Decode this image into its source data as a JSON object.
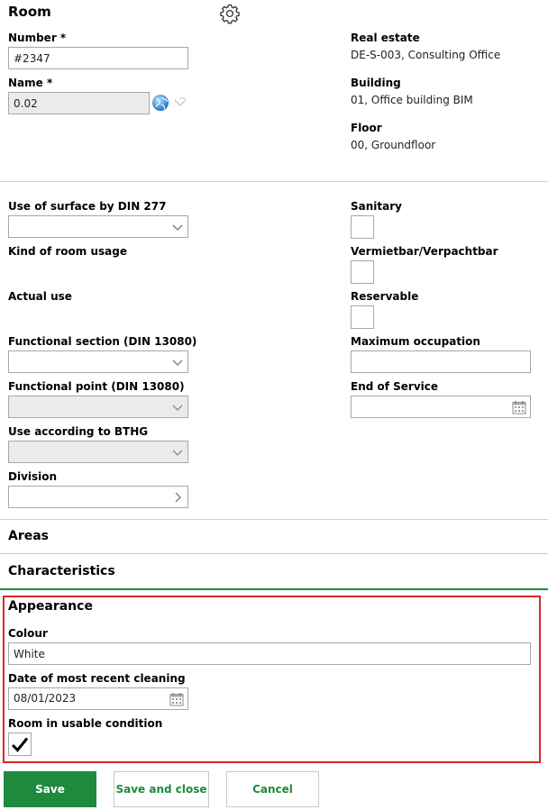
{
  "room": {
    "title": "Room",
    "number_label": "Number *",
    "number_value": "#2347",
    "name_label": "Name *",
    "name_value": "0.02",
    "real_estate_label": "Real estate",
    "real_estate_value": "DE-S-003, Consulting Office",
    "building_label": "Building",
    "building_value": "01, Office building BIM",
    "floor_label": "Floor",
    "floor_value": "00, Groundfloor"
  },
  "usage": {
    "surface_label": "Use of surface by DIN 277",
    "surface_value": "",
    "kind_label": "Kind of room usage",
    "actual_label": "Actual use",
    "functional_section_label": "Functional section (DIN 13080)",
    "functional_point_label": "Functional point (DIN 13080)",
    "bthg_label": "Use according to BTHG",
    "division_label": "Division",
    "sanitary_label": "Sanitary",
    "sanitary_checked": false,
    "rentable_label": "Vermietbar/Verpachtbar",
    "rentable_checked": false,
    "reservable_label": "Reservable",
    "reservable_checked": false,
    "max_occupation_label": "Maximum occupation",
    "max_occupation_value": "",
    "end_of_service_label": "End of Service",
    "end_of_service_value": ""
  },
  "sections": {
    "areas_title": "Areas",
    "characteristics_title": "Characteristics"
  },
  "appearance": {
    "title": "Appearance",
    "colour_label": "Colour",
    "colour_value": "White",
    "cleaning_label": "Date of most recent cleaning",
    "cleaning_value": "08/01/2023",
    "usable_label": "Room in usable condition",
    "usable_checked": true
  },
  "buttons": {
    "save": "Save",
    "save_close": "Save and close",
    "cancel": "Cancel"
  },
  "colors": {
    "accent_green": "#1e8a3e",
    "highlight_red": "#d9262c"
  },
  "icons": {
    "settings": "gear-icon",
    "translate": "globe-icon",
    "dropdown": "chevron-down-icon",
    "navigate": "chevron-right-icon",
    "date": "calendar-icon",
    "checked": "checkmark-icon"
  }
}
